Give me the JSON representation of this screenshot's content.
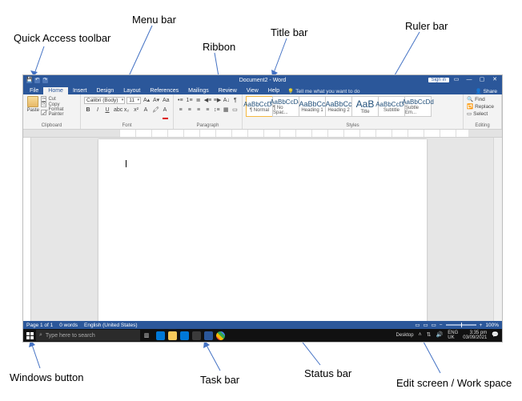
{
  "annotations": {
    "quick_access": "Quick Access toolbar",
    "menu_bar": "Menu bar",
    "ribbon": "Ribbon",
    "title_bar": "Title bar",
    "ruler_bar": "Ruler bar",
    "windows_button": "Windows button",
    "task_bar": "Task bar",
    "status_bar": "Status bar",
    "edit_screen": "Edit screen / Work space"
  },
  "title": {
    "document": "Document2 - Word",
    "signin": "Sign in"
  },
  "menu": {
    "items": [
      "File",
      "Home",
      "Insert",
      "Design",
      "Layout",
      "References",
      "Mailings",
      "Review",
      "View",
      "Help"
    ],
    "tellme": "Tell me what you want to do",
    "share": "Share"
  },
  "ribbon": {
    "clipboard": {
      "paste": "Paste",
      "cut": "Cut",
      "copy": "Copy",
      "format_painter": "Format Painter",
      "label": "Clipboard"
    },
    "font": {
      "name": "Calibri (Body)",
      "size": "11",
      "label": "Font"
    },
    "paragraph": {
      "label": "Paragraph"
    },
    "styles": {
      "label": "Styles",
      "items": [
        {
          "preview": "AaBbCcDd",
          "name": "¶ Normal"
        },
        {
          "preview": "AaBbCcDd",
          "name": "¶ No Spac..."
        },
        {
          "preview": "AaBbCc",
          "name": "Heading 1"
        },
        {
          "preview": "AaBbCc",
          "name": "Heading 2"
        },
        {
          "preview": "AaB",
          "name": "Title"
        },
        {
          "preview": "AaBbCcDd",
          "name": "Subtitle"
        },
        {
          "preview": "AaBbCcDd",
          "name": "Subtle Em..."
        }
      ]
    },
    "editing": {
      "find": "Find",
      "replace": "Replace",
      "select": "Select",
      "label": "Editing"
    }
  },
  "status": {
    "page": "Page 1 of 1",
    "words": "0 words",
    "lang": "English (United States)",
    "zoom": "100%"
  },
  "taskbar": {
    "search_placeholder": "Type here to search",
    "desktop": "Desktop",
    "lang": "ENG",
    "kb": "UK",
    "time": "3:35 pm",
    "date": "03/09/2021"
  }
}
